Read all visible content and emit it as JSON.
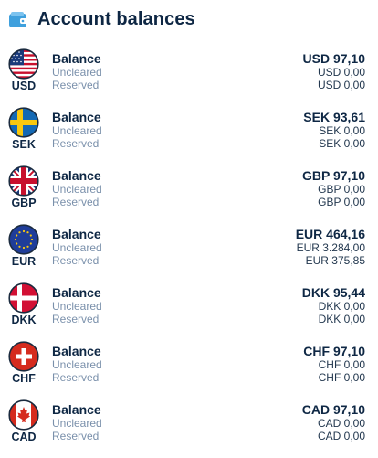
{
  "header": {
    "title": "Account balances",
    "icon": "wallet-icon"
  },
  "colors": {
    "title": "#0e2744",
    "muted": "#7a90ab",
    "icon_blue": "#3fa0dd"
  },
  "accounts": [
    {
      "code": "USD",
      "flag": "us-flag-icon",
      "balance_label": "Balance",
      "uncleared_label": "Uncleared",
      "reserved_label": "Reserved",
      "balance": "USD 97,10",
      "uncleared": "USD 0,00",
      "reserved": "USD 0,00"
    },
    {
      "code": "SEK",
      "flag": "se-flag-icon",
      "balance_label": "Balance",
      "uncleared_label": "Uncleared",
      "reserved_label": "Reserved",
      "balance": "SEK 93,61",
      "uncleared": "SEK 0,00",
      "reserved": "SEK 0,00"
    },
    {
      "code": "GBP",
      "flag": "gb-flag-icon",
      "balance_label": "Balance",
      "uncleared_label": "Uncleared",
      "reserved_label": "Reserved",
      "balance": "GBP 97,10",
      "uncleared": "GBP 0,00",
      "reserved": "GBP 0,00"
    },
    {
      "code": "EUR",
      "flag": "eu-flag-icon",
      "balance_label": "Balance",
      "uncleared_label": "Uncleared",
      "reserved_label": "Reserved",
      "balance": "EUR 464,16",
      "uncleared": "EUR 3.284,00",
      "reserved": "EUR 375,85"
    },
    {
      "code": "DKK",
      "flag": "dk-flag-icon",
      "balance_label": "Balance",
      "uncleared_label": "Uncleared",
      "reserved_label": "Reserved",
      "balance": "DKK 95,44",
      "uncleared": "DKK 0,00",
      "reserved": "DKK 0,00"
    },
    {
      "code": "CHF",
      "flag": "ch-flag-icon",
      "balance_label": "Balance",
      "uncleared_label": "Uncleared",
      "reserved_label": "Reserved",
      "balance": "CHF 97,10",
      "uncleared": "CHF 0,00",
      "reserved": "CHF 0,00"
    },
    {
      "code": "CAD",
      "flag": "ca-flag-icon",
      "balance_label": "Balance",
      "uncleared_label": "Uncleared",
      "reserved_label": "Reserved",
      "balance": "CAD 97,10",
      "uncleared": "CAD 0,00",
      "reserved": "CAD 0,00"
    }
  ]
}
